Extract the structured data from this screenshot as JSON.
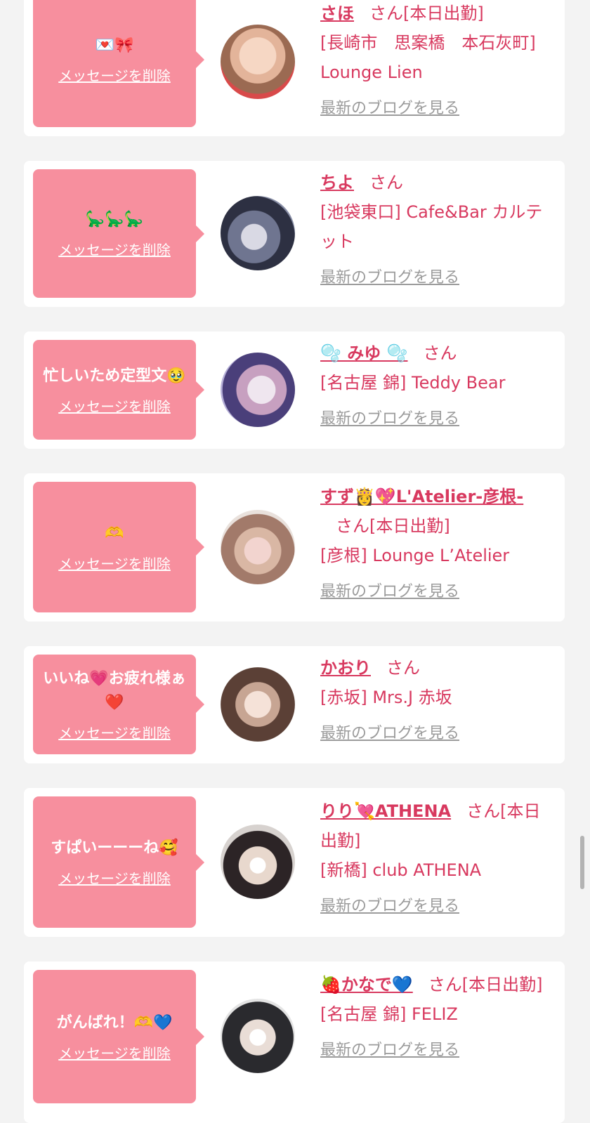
{
  "delete_label": "メッセージを削除",
  "blog_label": "最新のブログを見る",
  "san_label": "さん",
  "colors": {
    "background": "#f3f3f3",
    "card": "#ffffff",
    "bubble": "#f78f9e",
    "accent": "#d8395f",
    "muted": "#9b9b9b"
  },
  "cards": [
    {
      "message": "💌🎀",
      "name": "さほ",
      "suffix": "[本日出勤]",
      "shop": "[長崎市　思案橋　本石灰町] Lounge Lien"
    },
    {
      "message": "🦕🦕🦕",
      "name": "ちよ",
      "suffix": "",
      "shop": "[池袋東口] Cafe&Bar カルテット"
    },
    {
      "message": "忙しいため定型文🥹",
      "name": "🫧 みゆ 🫧",
      "suffix": "",
      "shop": "[名古屋 錦] Teddy Bear"
    },
    {
      "message": "🫶",
      "name": "すず👸💖L'Atelier-彦根-",
      "suffix": "[本日出勤]",
      "shop": "[彦根] Lounge L’Atelier"
    },
    {
      "message": "いいね💗お疲れ様ぁ❤️",
      "name": "かおり",
      "suffix": "",
      "shop": "[赤坂] Mrs.J 赤坂"
    },
    {
      "message": "すぱいーーーね🥰",
      "name": "りり💘ATHENA",
      "suffix": "[本日出勤]",
      "shop": "[新橋] club ATHENA"
    },
    {
      "message": "がんばれ！🫶💙",
      "name": "🍓かなで💙",
      "suffix": "[本日出勤]",
      "shop": "[名古屋 錦] FELIZ"
    }
  ]
}
